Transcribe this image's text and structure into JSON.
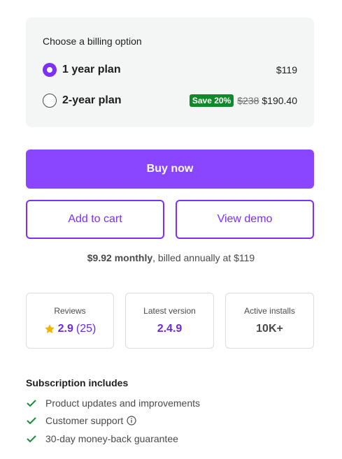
{
  "billing": {
    "title": "Choose a billing option",
    "plans": [
      {
        "name": "1 year plan",
        "price": "$119",
        "selected": true
      },
      {
        "name": "2-year plan",
        "badge": "Save 20%",
        "old_price": "$238",
        "price": "$190.40",
        "selected": false
      }
    ]
  },
  "actions": {
    "buy_label": "Buy now",
    "cart_label": "Add to cart",
    "demo_label": "View demo"
  },
  "pricing_note": {
    "monthly": "$9.92 monthly",
    "rest": ", billed annually at $119"
  },
  "stats": {
    "reviews_label": "Reviews",
    "rating": "2.9",
    "review_count": "(25)",
    "version_label": "Latest version",
    "version": "2.4.9",
    "installs_label": "Active installs",
    "installs": "10K+"
  },
  "subscription": {
    "title": "Subscription includes",
    "items": [
      "Product updates and improvements",
      "Customer support",
      "30-day money-back guarantee"
    ]
  },
  "colors": {
    "accent": "#8a45ff",
    "accent_text": "#7b2ff7",
    "save_badge": "#0e8a2a",
    "check": "#1e8a3c",
    "star": "#f0b400"
  }
}
